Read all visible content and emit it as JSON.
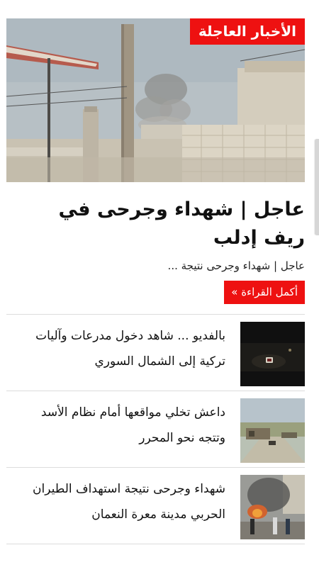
{
  "hero": {
    "badge": "الأخبار العاجلة",
    "image": "street-smoke-photo"
  },
  "featured": {
    "headline": "عاجل | شهداء وجرحى في ريف إدلب",
    "summary": "عاجل | شهداء وجرحى نتيجة ...",
    "read_more": "أكمل القراءة »"
  },
  "news": [
    {
      "title": "بالفديو ... شاهد دخول مدرعات وآليات تركية إلى الشمال السوري",
      "thumb": "night-video-thumbnail"
    },
    {
      "title": "داعش تخلي مواقعها أمام نظام الأسد وتتجه نحو المحرر",
      "thumb": "road-checkpoint-thumbnail"
    },
    {
      "title": "شهداء وجرحى نتيجة استهداف الطيران الحربي مدينة معرة النعمان",
      "thumb": "airstrike-aftermath-thumbnail"
    }
  ],
  "colors": {
    "accent": "#ee1111",
    "divider": "#dcdcdc",
    "text": "#111111"
  }
}
